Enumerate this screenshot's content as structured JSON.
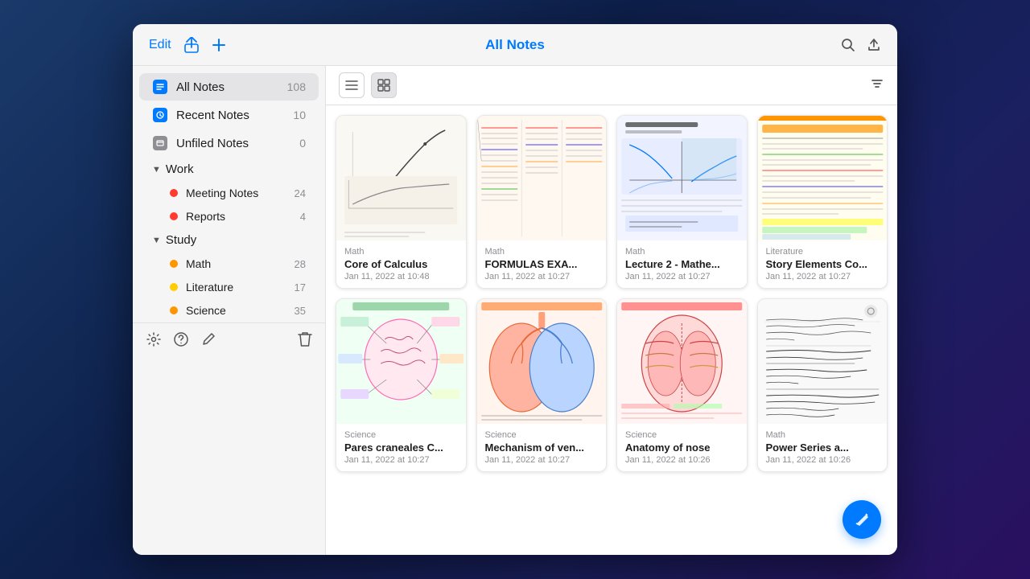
{
  "header": {
    "edit_label": "Edit",
    "title": "All Notes",
    "share_icon": "↑",
    "add_icon": "+",
    "search_icon": "🔍",
    "export_icon": "⬆"
  },
  "sidebar": {
    "all_notes": {
      "label": "All Notes",
      "count": 108
    },
    "recent_notes": {
      "label": "Recent Notes",
      "count": 10
    },
    "unfiled_notes": {
      "label": "Unfiled Notes",
      "count": 0
    },
    "sections": [
      {
        "label": "Work",
        "items": [
          {
            "label": "Meeting Notes",
            "count": 24,
            "color": "red"
          },
          {
            "label": "Reports",
            "count": 4,
            "color": "red"
          }
        ]
      },
      {
        "label": "Study",
        "items": [
          {
            "label": "Math",
            "count": 28,
            "color": "orange"
          },
          {
            "label": "Literature",
            "count": 17,
            "color": "yellow"
          },
          {
            "label": "Science",
            "count": 35,
            "color": "orange"
          }
        ]
      }
    ],
    "footer": {
      "settings_icon": "⚙",
      "help_icon": "?",
      "pen_icon": "✏",
      "trash_icon": "🗑"
    }
  },
  "toolbar": {
    "list_view_icon": "☰",
    "grid_view_icon": "⊞",
    "sort_icon": "⇅"
  },
  "notes": [
    {
      "category": "Math",
      "title": "Core of Calculus",
      "date": "Jan 11, 2022 at 10:48",
      "thumb_type": "math1"
    },
    {
      "category": "Math",
      "title": "FORMULAS EXA...",
      "date": "Jan 11, 2022 at 10:27",
      "thumb_type": "math2"
    },
    {
      "category": "Math",
      "title": "Lecture 2 - Mathe...",
      "date": "Jan 11, 2022 at 10:27",
      "thumb_type": "math3"
    },
    {
      "category": "Literature",
      "title": "Story Elements Co...",
      "date": "Jan 11, 2022 at 10:27",
      "thumb_type": "lit"
    },
    {
      "category": "Science",
      "title": "Pares craneales C...",
      "date": "Jan 11, 2022 at 10:27",
      "thumb_type": "science1"
    },
    {
      "category": "Science",
      "title": "Mechanism of ven...",
      "date": "Jan 11, 2022 at 10:27",
      "thumb_type": "science2"
    },
    {
      "category": "Science",
      "title": "Anatomy of nose",
      "date": "Jan 11, 2022 at 10:26",
      "thumb_type": "science3"
    },
    {
      "category": "Math",
      "title": "Power Series a...",
      "date": "Jan 11, 2022 at 10:26",
      "thumb_type": "math4"
    }
  ]
}
